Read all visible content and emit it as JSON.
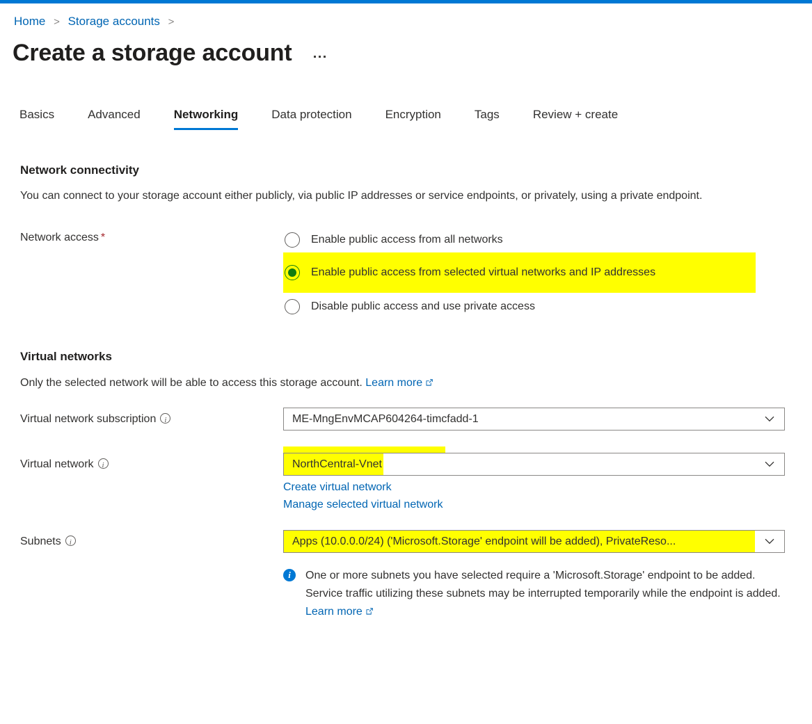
{
  "theme": {
    "accent": "#0078d4",
    "link": "#0065b3",
    "highlight": "#ffff00",
    "required_asterisk": "#a4262c",
    "radio_selected": "#107c10"
  },
  "breadcrumb": {
    "items": [
      {
        "label": "Home"
      },
      {
        "label": "Storage accounts"
      }
    ],
    "separator": ">"
  },
  "header": {
    "title": "Create a storage account",
    "more_label": "..."
  },
  "tabs": [
    {
      "label": "Basics",
      "active": false
    },
    {
      "label": "Advanced",
      "active": false
    },
    {
      "label": "Networking",
      "active": true
    },
    {
      "label": "Data protection",
      "active": false
    },
    {
      "label": "Encryption",
      "active": false
    },
    {
      "label": "Tags",
      "active": false
    },
    {
      "label": "Review + create",
      "active": false
    }
  ],
  "network_connectivity": {
    "heading": "Network connectivity",
    "description": "You can connect to your storage account either publicly, via public IP addresses or service endpoints, or privately, using a private endpoint.",
    "network_access": {
      "label": "Network access",
      "required_mark": "*",
      "options": [
        {
          "label": "Enable public access from all networks",
          "selected": false,
          "highlighted": false
        },
        {
          "label": "Enable public access from selected virtual networks and IP addresses",
          "selected": true,
          "highlighted": true
        },
        {
          "label": "Disable public access and use private access",
          "selected": false,
          "highlighted": false
        }
      ]
    }
  },
  "virtual_networks": {
    "heading": "Virtual networks",
    "description": "Only the selected network will be able to access this storage account.",
    "learn_more": "Learn more",
    "subscription": {
      "label": "Virtual network subscription",
      "value": "ME-MngEnvMCAP604264-timcfadd-1",
      "highlighted": false
    },
    "vnet": {
      "label": "Virtual network",
      "value": "NorthCentral-Vnet",
      "highlighted": true,
      "links": [
        "Create virtual network",
        "Manage selected virtual network"
      ]
    },
    "subnets": {
      "label": "Subnets",
      "value": "Apps (10.0.0.0/24) ('Microsoft.Storage' endpoint will be added), PrivateReso...",
      "highlighted": true
    },
    "notice": {
      "icon": "info-icon",
      "text": "One or more subnets you have selected require a 'Microsoft.Storage' endpoint to be added. Service traffic utilizing these subnets may be interrupted temporarily while the endpoint is added.",
      "learn_more": "Learn more"
    }
  }
}
